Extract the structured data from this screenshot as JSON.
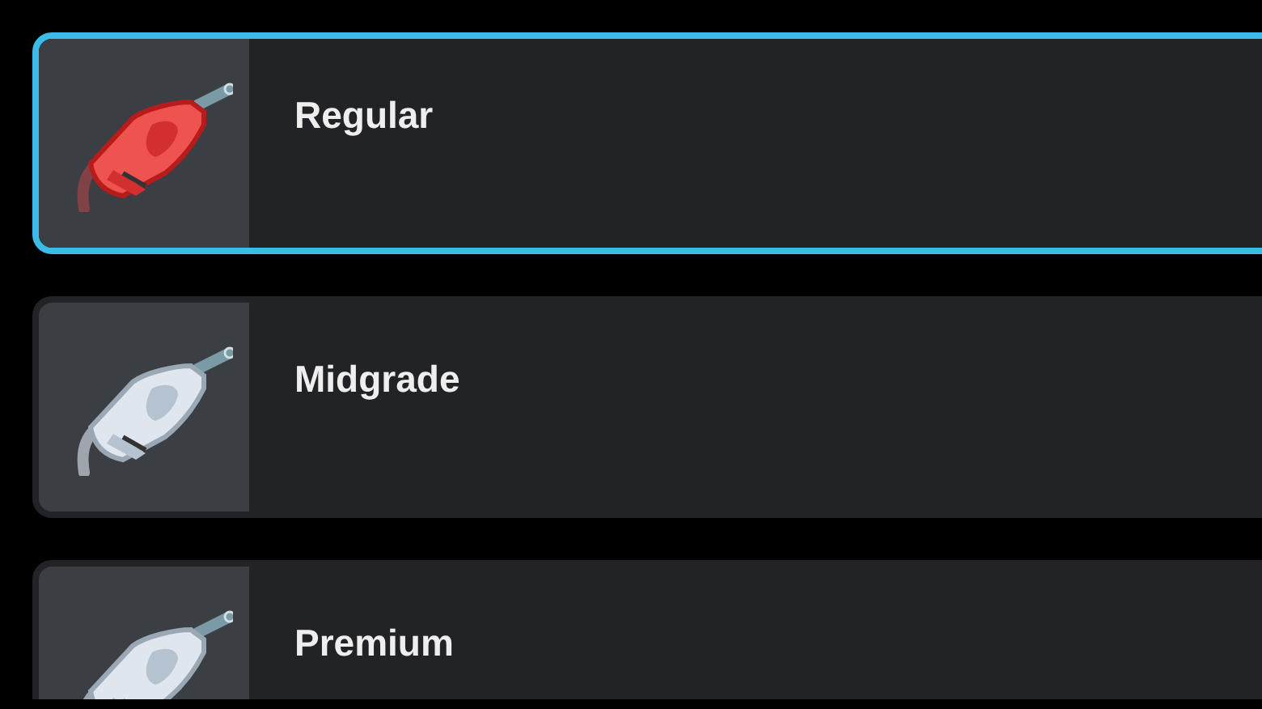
{
  "fuel_options": [
    {
      "label": "Regular",
      "selected": true
    },
    {
      "label": "Midgrade",
      "selected": false
    },
    {
      "label": "Premium",
      "selected": false
    }
  ]
}
